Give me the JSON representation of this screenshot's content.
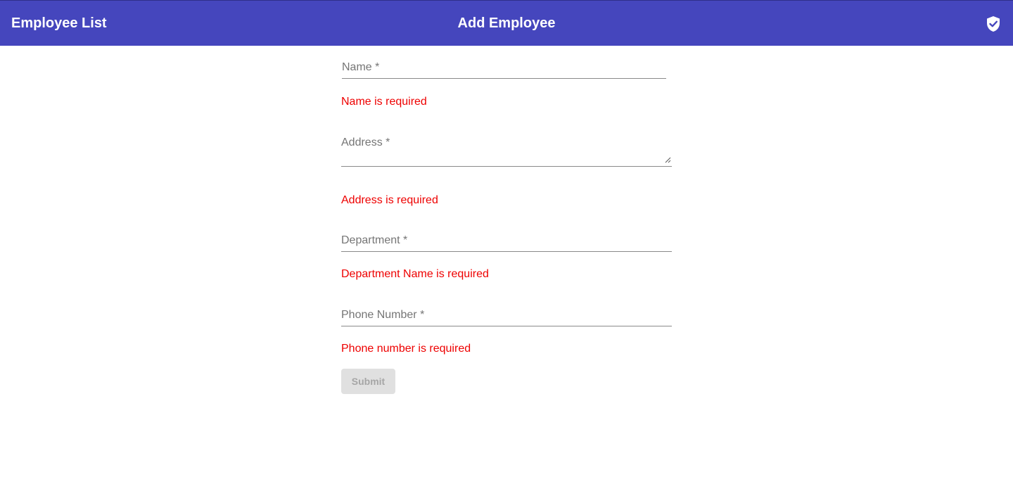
{
  "header": {
    "nav_link": "Employee List",
    "title": "Add Employee",
    "icon": "shield-check-icon",
    "background_color": "#4546bd"
  },
  "form": {
    "fields": [
      {
        "label": "Name *",
        "error": "Name is required"
      },
      {
        "label": "Address *",
        "error": "Address is required"
      },
      {
        "label": "Department *",
        "error": "Department Name is required"
      },
      {
        "label": "Phone Number *",
        "error": "Phone number is required"
      }
    ],
    "submit_label": "Submit",
    "error_color": "#ee0000"
  }
}
